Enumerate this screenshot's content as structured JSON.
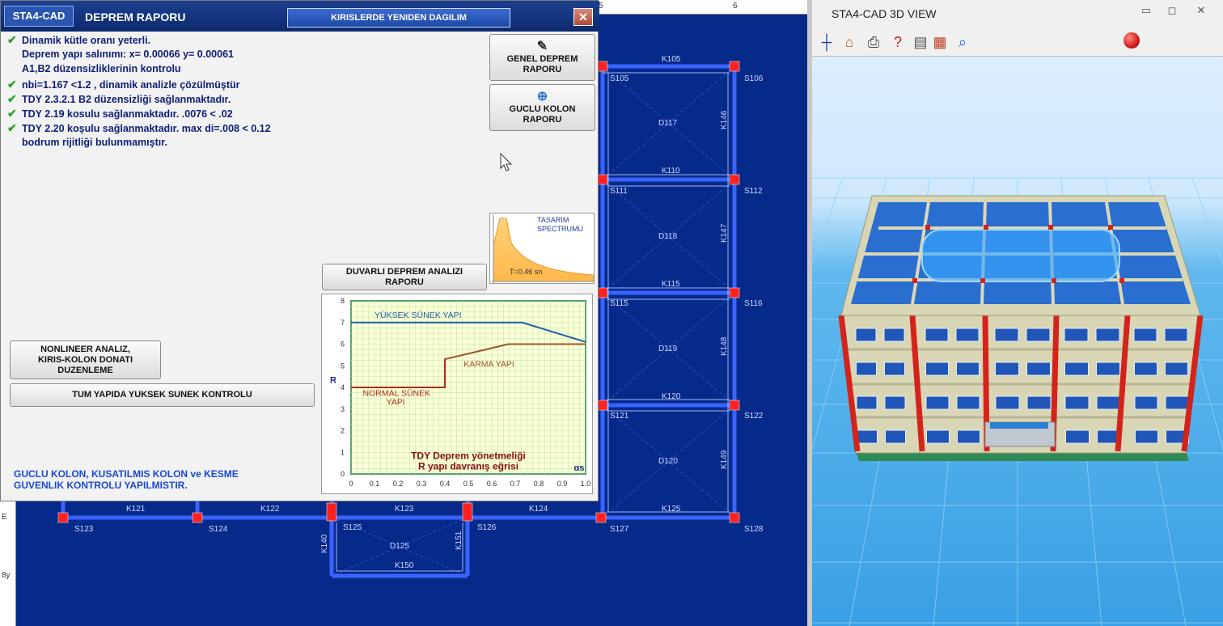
{
  "dialog": {
    "app_badge": "STA4-CAD",
    "title": "DEPREM RAPORU",
    "tab": "KIRISLERDE YENIDEN DAGILIM",
    "close": "✕",
    "lines": [
      {
        "check": true,
        "text": "Dinamik kütle oranı yeterli."
      },
      {
        "check": false,
        "text": "Deprem yapı salınımı: x=  0.00066  y=  0.00061"
      },
      {
        "check": false,
        "text": "A1,B2  düzensizliklerinin kontrolu"
      },
      {
        "check": true,
        "text": "nbi=1.167 <1.2 , dinamik analizle çözülmüştür"
      },
      {
        "check": true,
        "text": "TDY 2.3.2.1 B2  düzensizliği sağlanmaktadır."
      },
      {
        "check": true,
        "text": "TDY 2.19 kosulu sağlanmaktadır. .0076 < .02"
      },
      {
        "check": true,
        "text": "TDY 2.20 koşulu sağlanmaktadır.  max di=.008 < 0.12"
      },
      {
        "check": false,
        "text": "bodrum rijitliği bulunmamıştır."
      }
    ],
    "buttons": {
      "genel_deprem": [
        "GENEL DEPREM",
        "RAPORU"
      ],
      "guclu_kolon": [
        "GUCLU KOLON",
        "RAPORU"
      ],
      "duvarli": [
        "DUVARLI DEPREM ANALIZI",
        "RAPORU"
      ],
      "nonlineer": [
        "NONLINEER ANALIZ,",
        "KIRIS-KOLON DONATI",
        "DUZENLEME"
      ],
      "tum_yapida": "TUM YAPIDA YUKSEK SUNEK KONTROLU"
    },
    "spectrum_thumb": {
      "title": [
        "TASARIM",
        "SPECTRUMU"
      ],
      "label": "T=0.46 sn"
    },
    "footer": [
      "GUCLU KOLON, KUSATILMIS KOLON ve KESME",
      "GUVENLIK KONTROLU YAPILMISTIR."
    ]
  },
  "chart_data": {
    "type": "line",
    "title": "TDY Deprem yönetmeliği",
    "subtitle": "R  yapı davranış eğrisi",
    "xlabel": "αs",
    "ylabel": "R",
    "xlim": [
      0,
      1.0
    ],
    "ylim": [
      0,
      8
    ],
    "x_ticks": [
      "0",
      "0.1",
      "0.2",
      "0.3",
      "0.4",
      "0.5",
      "0.6",
      "0.7",
      "0.8",
      "0.9",
      "1.0"
    ],
    "y_ticks": [
      "0",
      "1",
      "2",
      "3",
      "4",
      "5",
      "6",
      "7",
      "8"
    ],
    "grid": true,
    "series": [
      {
        "name": "YÜKSEK SÜNEK YAPI",
        "color": "#1f5fa8",
        "points": [
          [
            0,
            7
          ],
          [
            0.73,
            7
          ],
          [
            1.0,
            6.1
          ]
        ]
      },
      {
        "name": "KARMA YAPI",
        "color": "#a0522d",
        "points": [
          [
            0.4,
            5
          ],
          [
            0.4,
            5.3
          ],
          [
            0.67,
            6
          ],
          [
            1.0,
            6
          ]
        ]
      },
      {
        "name": "NORMAL SÜNEK YAPI",
        "color": "#b02a1a",
        "points": [
          [
            0,
            4
          ],
          [
            0.4,
            4
          ],
          [
            0.4,
            5.3
          ]
        ]
      }
    ]
  },
  "plan": {
    "beams": [
      "K105",
      "K110",
      "K115",
      "K120",
      "K125",
      "K121",
      "K122",
      "K123",
      "K124",
      "K150",
      "K146",
      "K147",
      "K148",
      "K149",
      "K140",
      "K151"
    ],
    "columns": [
      "S105",
      "S106",
      "S111",
      "S112",
      "S115",
      "S116",
      "S121",
      "S122",
      "S123",
      "S124",
      "S125",
      "S126",
      "S127",
      "S128"
    ],
    "slabs": [
      "D117",
      "D118",
      "D119",
      "D120",
      "D125"
    ],
    "ruler_top": [
      "5",
      "6"
    ],
    "ruler_left": [
      "E",
      "8y"
    ]
  },
  "view3d": {
    "title": "STA4-CAD  3D VIEW",
    "controls": [
      "▭",
      "◻",
      "✕"
    ],
    "tools": [
      "grid-axis",
      "home",
      "print",
      "help",
      "toggle",
      "brick",
      "zoom"
    ]
  },
  "colors": {
    "plan_bg": "#062a8a",
    "beam": "#3a63ff",
    "column": "#ff2020",
    "dialog_bg": "#f2f2f2",
    "report_text": "#0d1e78"
  }
}
